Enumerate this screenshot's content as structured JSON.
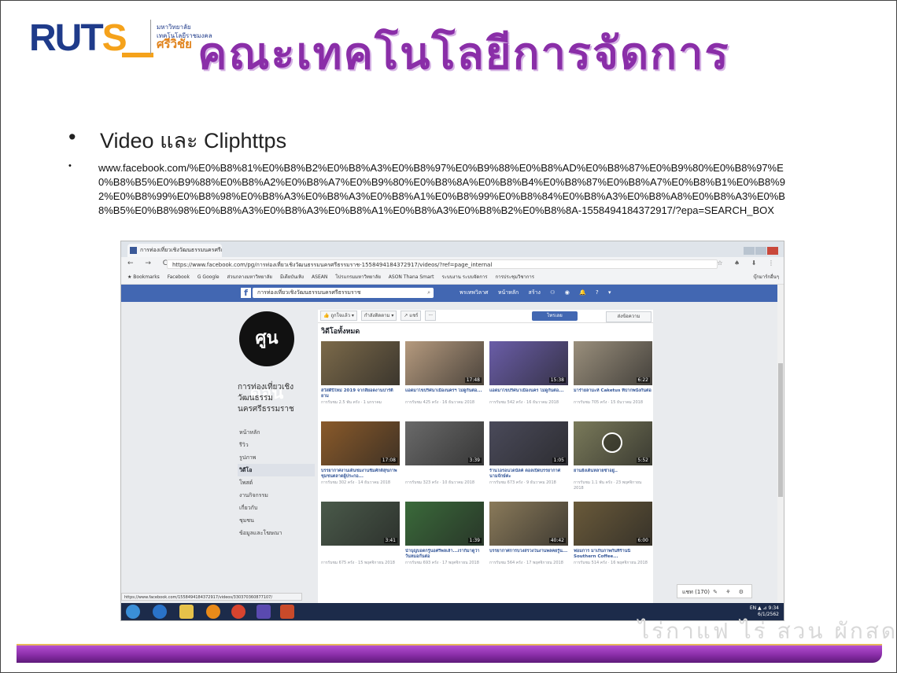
{
  "header": {
    "logo_text_ru": "RUT",
    "logo_text_s": "S",
    "university_line": "มหาวิทยาลัย เทคโนโลยีราชมงคล",
    "university_campus": "ศรีวิชัย",
    "faculty_title": "คณะเทคโนโลยีการจัดการ"
  },
  "bullets": [
    {
      "symbol": "•",
      "text": "Video และ Cliphttps"
    },
    {
      "symbol": "•",
      "text": "www.facebook.com/%E0%B8%81%E0%B8%B2%E0%B8%A3%E0%B8%97%E0%B9%88%E0%B8%AD%E0%B8%87%E0%B9%80%E0%B8%97%E0%B8%B5%E0%B9%88%E0%B8%A2%E0%B8%A7%E0%B9%80%E0%B8%8A%E0%B8%B4%E0%B8%87%E0%B8%A7%E0%B8%B1%E0%B8%92%E0%B8%99%E0%B8%98%E0%B8%A3%E0%B8%A3%E0%B8%A1%E0%B8%99%E0%B8%84%E0%B8%A3%E0%B8%A8%E0%B8%A3%E0%B8%B5%E0%B8%98%E0%B8%A3%E0%B8%A3%E0%B8%A1%E0%B8%A3%E0%B8%B2%E0%B8%8A-1558494184372917/?epa=SEARCH_BOX"
    }
  ],
  "browser": {
    "tab_title": "การท่องเที่ยวเชิงวัฒนธรรมนครศรีธรรมราช",
    "nav_glyphs": "← → C",
    "address": "https://www.facebook.com/pg/การท่องเที่ยวเชิงวัฒนธรรมนครศรีธรรมราช-1558494184372917/videos/?ref=page_internal",
    "tools_glyphs": "☆ ♠ ⬇ ⋮",
    "bookmarks": [
      "★ Bookmarks",
      "Facebook",
      "G Google",
      "ส่วนกลางมหาวิทยาลัย",
      "มีเดียบันเทิง",
      "ASEAN",
      "โปรแกรมมหาวิทยาลัย",
      "ASON Thana Smart",
      "ระบบงาน ระบบจัดการ",
      "การประชุมวิชาการ"
    ],
    "other_bookmarks": "บุ๊กมาร์กอื่นๆ"
  },
  "facebook": {
    "logo": "f",
    "search_value": "การท่องเที่ยวเชิงวัฒนธรรมนครศรีธรรมราช",
    "search_icon": "search-icon",
    "top_items": [
      "พรเทพวิลาศ",
      "หน้าหลัก",
      "สร้าง"
    ],
    "page_avatar_text": "ศูน ดอน",
    "page_name": "การท่องเที่ยวเชิงวัฒนธรรมนครศรีธรรมราช",
    "left_nav": [
      "หน้าหลัก",
      "รีวิว",
      "รูปภาพ",
      "วิดีโอ",
      "โพสต์",
      "งานกิจกรรม",
      "เกี่ยวกับ",
      "ชุมชน",
      "ข้อมูลและโฆษณา"
    ],
    "active_nav": "วิดีโอ",
    "action_like": "👍 ถูกใจแล้ว ▾",
    "action_follow": "กำลังติดตาม ▾",
    "action_share": "↗ แชร์",
    "action_more": "···",
    "action_shop": "ไทรเลย",
    "action_message": "ส่งข้อความ",
    "videos_heading": "วิดีโอทั้งหมด",
    "videos": [
      {
        "title": "สวัสดีปีใหม่ 2019 จากสี่ยอดงานปาร์ตี้ยาม",
        "meta": "การรับชม 2.5 พัน ครั้ง · 1 มกราคม",
        "duration": "",
        "color": "#7c6a4a"
      },
      {
        "title": "แอดมาไขปริศนาเมืองนครฯ ไม่ดูกันต่อ...",
        "meta": "การรับชม 425 ครั้ง · 16 ธันวาคม 2018",
        "duration": "17:48",
        "color": "#b59a7e"
      },
      {
        "title": "แอดมาไขปริศนาเมืองนคร ไม่ดูกันต่อ...",
        "meta": "การรับชม 542 ครั้ง · 16 ธันวาคม 2018",
        "duration": "15:38",
        "color": "#6a5da8"
      },
      {
        "title": "มารำยลามะห์ Caketus ที่ปากพนังกันต่อ",
        "meta": "การรับชม 705 ครั้ง · 15 ธันวาคม 2018",
        "duration": "6:22",
        "color": "#9a8f7c"
      },
      {
        "title": "บรรยากาศงานเดินชมงานชิมศักดิ์สุขภาพชุมชนตลาดผู้ประกอ...",
        "meta": "การรับชม 302 ครั้ง · 14 ธันวาคม 2018",
        "duration": "17:08",
        "color": "#8a5a2a"
      },
      {
        "title": "",
        "meta": "การรับชม 323 ครั้ง · 10 ธันวาคม 2018",
        "duration": "3:39",
        "color": "#6a6a6a"
      },
      {
        "title": "ร้านโอรอนโดนัลค์ ดอลเปิดบรรยากาศนามจักษ์ค่ะ",
        "meta": "การรับชม 673 ครั้ง · 9 ธันวาคม 2018",
        "duration": "1:05",
        "color": "#4a4a5a"
      },
      {
        "title": "ยานยังเดินหลายซ่าอยู่..",
        "meta": "การรับชม 1.1 พัน ครั้ง · 23 พฤศจิกายน 2018",
        "duration": "5:52",
        "color": "#7a7a5a"
      },
      {
        "title": "",
        "meta": "การรับชม 675 ครั้ง · 15 พฤศจิกายน 2018",
        "duration": "3:41",
        "color": "#4a5a4a"
      },
      {
        "title": "นำบุญบอดกรู้นอศรีพลเล้า...เราก็มาดูว่าวันหมอกันต่อ",
        "meta": "การรับชม 693 ครั้ง · 17 พฤศจิกายน 2018",
        "duration": "1:39",
        "color": "#3a6a3a"
      },
      {
        "title": "บรรยากาศการบวงสรวงในงานพลคยรู้น...",
        "meta": "การรับชม 564 ครั้ง · 17 พฤศจิกายน 2018",
        "duration": "40:42",
        "color": "#8a7a5a"
      },
      {
        "title": "ฟอมการ มาเก็บภาพกันที่ร้านนี้ Southern Coffee...",
        "meta": "การรับชม 514 ครั้ง · 16 พฤศจิกายน 2018",
        "duration": "6:00",
        "color": "#6a5a3a"
      }
    ],
    "chat_label": "แชท (170)",
    "chat_icons": "✎ ⚘ ⚙",
    "status_url": "https://www.facebook.com/1558494184372917/videos/330370360877107/"
  },
  "taskbar": {
    "tray_line1": "EN ▲ ⊿ 9:34",
    "tray_line2": "6/1/2562"
  },
  "footer": {
    "deco_text": "ไร่กาแฟ ไร่ สวน ผักสด"
  },
  "colors": {
    "title_purple": "#8a2ea8",
    "fb_blue": "#4267b2",
    "logo_blue": "#1f3b8a",
    "logo_orange": "#f5a21b"
  }
}
